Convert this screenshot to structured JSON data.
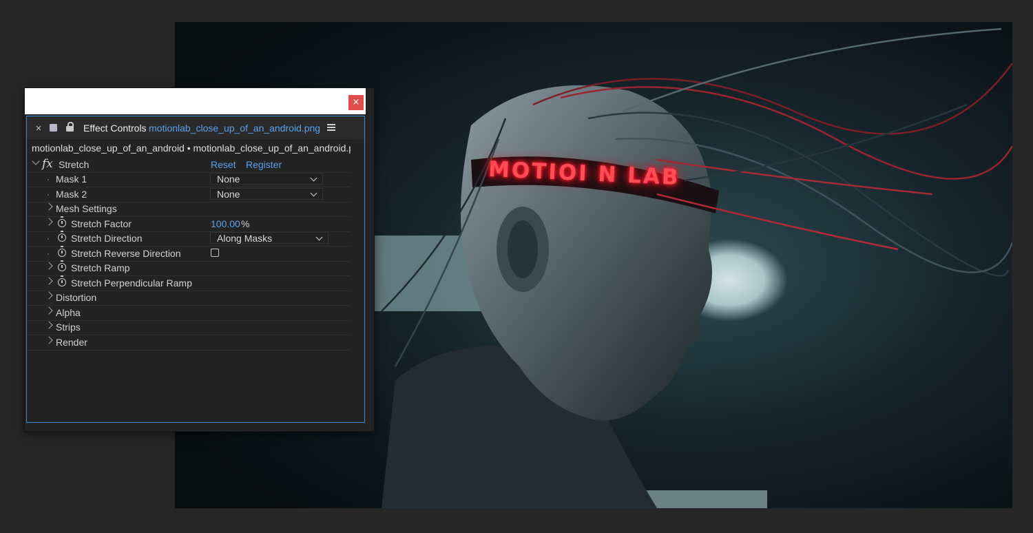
{
  "effect_controls": {
    "close_label": "×",
    "tab": {
      "close": "×",
      "title": "Effect Controls",
      "file": "motionlab_close_up_of_an_android.png"
    },
    "breadcrumb": "motionlab_close_up_of_an_android • motionlab_close_up_of_an_android.png",
    "effect": {
      "name": "Stretch",
      "reset": "Reset",
      "register": "Register"
    },
    "properties": {
      "mask1": {
        "label": "Mask 1",
        "value": "None"
      },
      "mask2": {
        "label": "Mask 2",
        "value": "None"
      },
      "mesh_settings": {
        "label": "Mesh Settings"
      },
      "stretch_factor": {
        "label": "Stretch Factor",
        "value": "100.00",
        "unit": "%"
      },
      "stretch_direction": {
        "label": "Stretch Direction",
        "value": "Along Masks"
      },
      "stretch_reverse_direction": {
        "label": "Stretch Reverse Direction",
        "checked": false
      },
      "stretch_ramp": {
        "label": "Stretch Ramp"
      },
      "stretch_perpendicular_ramp": {
        "label": "Stretch Perpendicular Ramp"
      },
      "distortion": {
        "label": "Distortion"
      },
      "alpha": {
        "label": "Alpha"
      },
      "strips": {
        "label": "Strips"
      },
      "render": {
        "label": "Render"
      }
    }
  },
  "composition": {
    "neon_text": "MOTIOI N LAB"
  },
  "colors": {
    "accent": "#5aa2ee",
    "panel_border": "#3e8bd6",
    "close_button": "#e04b4b",
    "neon": "#ff4d57"
  }
}
